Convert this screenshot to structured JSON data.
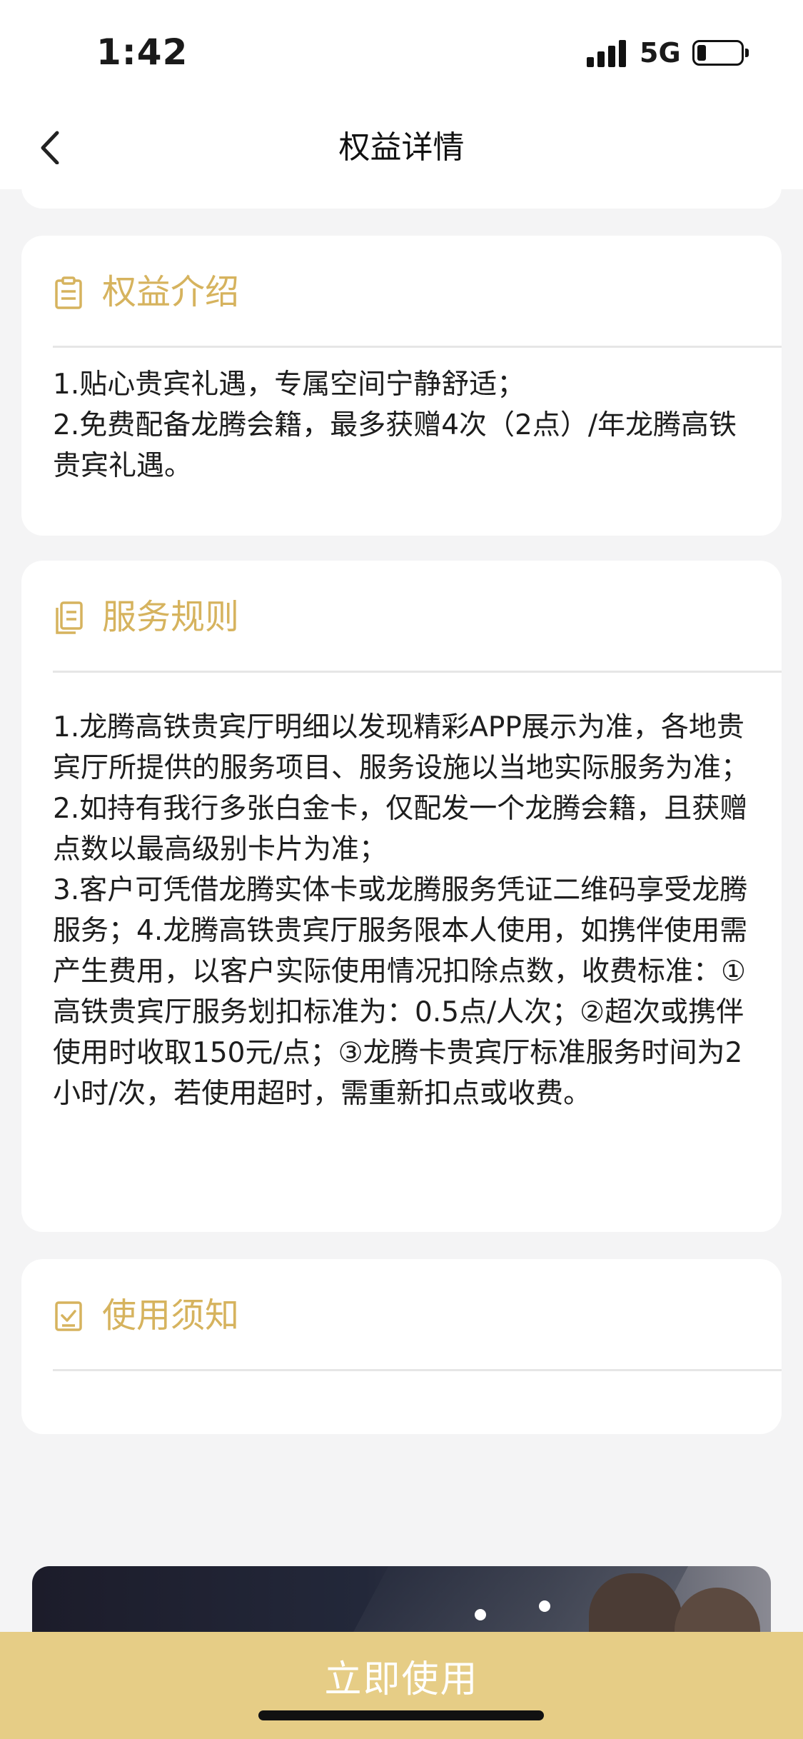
{
  "status_bar": {
    "time": "1:42",
    "network": "5G"
  },
  "nav": {
    "title": "权益详情"
  },
  "sections": [
    {
      "title": "权益介绍",
      "icon": "clipboard-icon",
      "lines": [
        "1.贴心贵宾礼遇，专属空间宁静舒适；",
        "2.免费配备龙腾会籍，最多获赠4次（2点）/年龙腾高铁贵宾礼遇。"
      ]
    },
    {
      "title": "服务规则",
      "icon": "document-icon",
      "lines": [
        "1.龙腾高铁贵宾厅明细以发现精彩APP展示为准，各地贵宾厅所提供的服务项目、服务设施以当地实际服务为准；",
        "2.如持有我行多张白金卡，仅配发一个龙腾会籍，且获赠点数以最高级别卡片为准；",
        "3.客户可凭借龙腾实体卡或龙腾服务凭证二维码享受龙腾服务；4.龙腾高铁贵宾厅服务限本人使用，如携伴使用需产生费用，以客户实际使用情况扣除点数，收费标准：①高铁贵宾厅服务划扣标准为：0.5点/人次；②超次或携伴使用时收取150元/点；③龙腾卡贵宾厅标准服务时间为2小时/次，若使用超时，需重新扣点或收费。"
      ]
    },
    {
      "title": "使用须知",
      "icon": "checkbox-icon",
      "lines": []
    }
  ],
  "bottom": {
    "button_label": "立即使用"
  },
  "colors": {
    "accent_gold": "#d6b35e",
    "button_bg": "#e6cd86",
    "page_bg": "#f4f4f5"
  }
}
